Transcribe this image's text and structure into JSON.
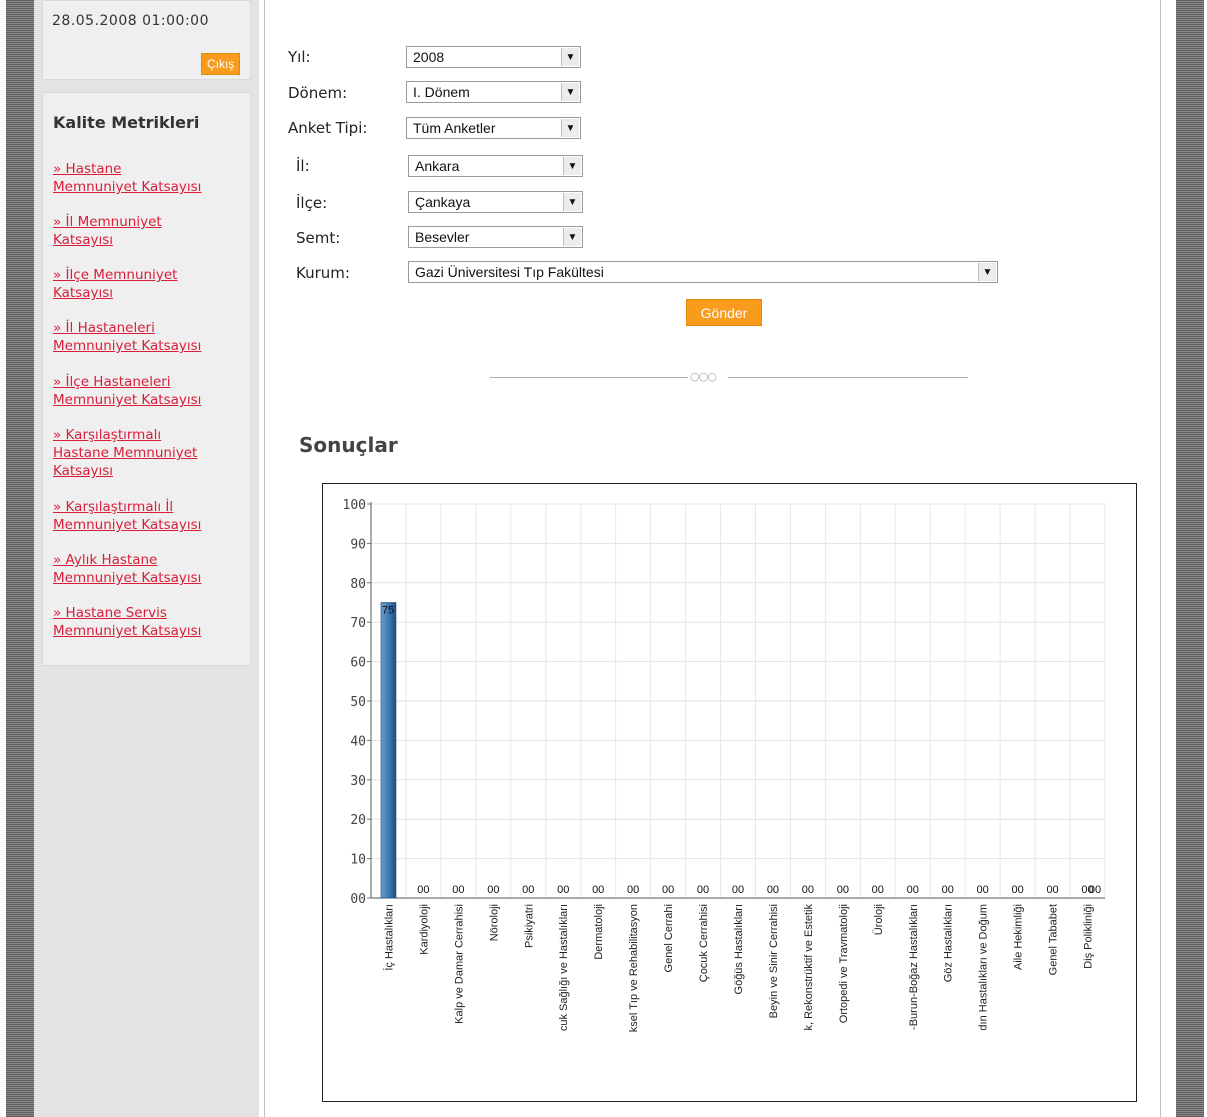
{
  "sidebar": {
    "datetime": "28.05.2008 01:00:00",
    "logout_label": "Çıkış",
    "menu_title": "Kalite Metrikleri",
    "items": [
      {
        "lines": [
          "» Hastane",
          "Memnuniyet Katsayısı"
        ]
      },
      {
        "lines": [
          "» İl Memnuniyet",
          "Katsayısı"
        ]
      },
      {
        "lines": [
          "» İlçe Memnuniyet",
          "Katsayısı"
        ]
      },
      {
        "lines": [
          "» İl Hastaneleri",
          "Memnuniyet Katsayısı"
        ]
      },
      {
        "lines": [
          "» İlçe Hastaneleri",
          "Memnuniyet Katsayısı"
        ]
      },
      {
        "lines": [
          "» Karşılaştırmalı",
          "Hastane Memnuniyet",
          "Katsayısı"
        ]
      },
      {
        "lines": [
          "» Karşılaştırmalı İl",
          "Memnuniyet Katsayısı"
        ]
      },
      {
        "lines": [
          "» Aylık Hastane",
          "Memnuniyet Katsayısı"
        ]
      },
      {
        "lines": [
          "» Hastane Servis",
          "Memnuniyet Katsayısı"
        ]
      }
    ]
  },
  "form": {
    "year_label": "Yıl:",
    "year_value": "2008",
    "period_label": "Dönem:",
    "period_value": "I. Dönem",
    "survey_label": "Anket Tipi:",
    "survey_value": "Tüm Anketler",
    "province_label": "İl:",
    "province_value": "Ankara",
    "district_label": "İlçe:",
    "district_value": "Çankaya",
    "neighborhood_label": "Semt:",
    "neighborhood_value": "Besevler",
    "institution_label": "Kurum:",
    "institution_value": "Gazi Üniversitesi Tıp Fakültesi",
    "submit_label": "Gönder",
    "divider_ornament": "○○○"
  },
  "results": {
    "title": "Sonuçlar"
  },
  "chart_data": {
    "type": "bar",
    "categories": [
      "İç Hastalıkları",
      "Kardiyoloji",
      "Kalp ve Damar Cerrahisi",
      "Nöroloji",
      "Psikiyatri",
      "cuk Sağlığı ve Hastalıkları",
      "Dermatoloji",
      "ksel Tıp ve Rehabilitasyon",
      "Genel Cerrahi",
      "Çocuk Cerrahisi",
      "Göğüs Hastalıkları",
      "Beyin ve Sinir Cerrahisi",
      "k, Rekonstrüktif ve Estetik",
      "Ortopedi ve Travmatoloji",
      "Üroloji",
      "-Burun-Boğaz Hastalıkları",
      "Göz Hastalıkları",
      "dın Hastalıkları ve Doğum",
      "Aile Hekimliği",
      "Genel Tababet",
      "Diş Polikliniği"
    ],
    "values": [
      75,
      0,
      0,
      0,
      0,
      0,
      0,
      0,
      0,
      0,
      0,
      0,
      0,
      0,
      0,
      0,
      0,
      0,
      0,
      0,
      0
    ],
    "value_labels": [
      "75",
      "00",
      "00",
      "00",
      "00",
      "00",
      "00",
      "00",
      "00",
      "00",
      "00",
      "00",
      "00",
      "00",
      "00",
      "00",
      "00",
      "00",
      "00",
      "00",
      "00",
      "00"
    ],
    "yticks": [
      "00",
      "10",
      "20",
      "30",
      "40",
      "50",
      "60",
      "70",
      "80",
      "90",
      "100"
    ],
    "ylim": [
      0,
      100
    ],
    "grid": true,
    "bar_color": "#3f7ab3"
  }
}
